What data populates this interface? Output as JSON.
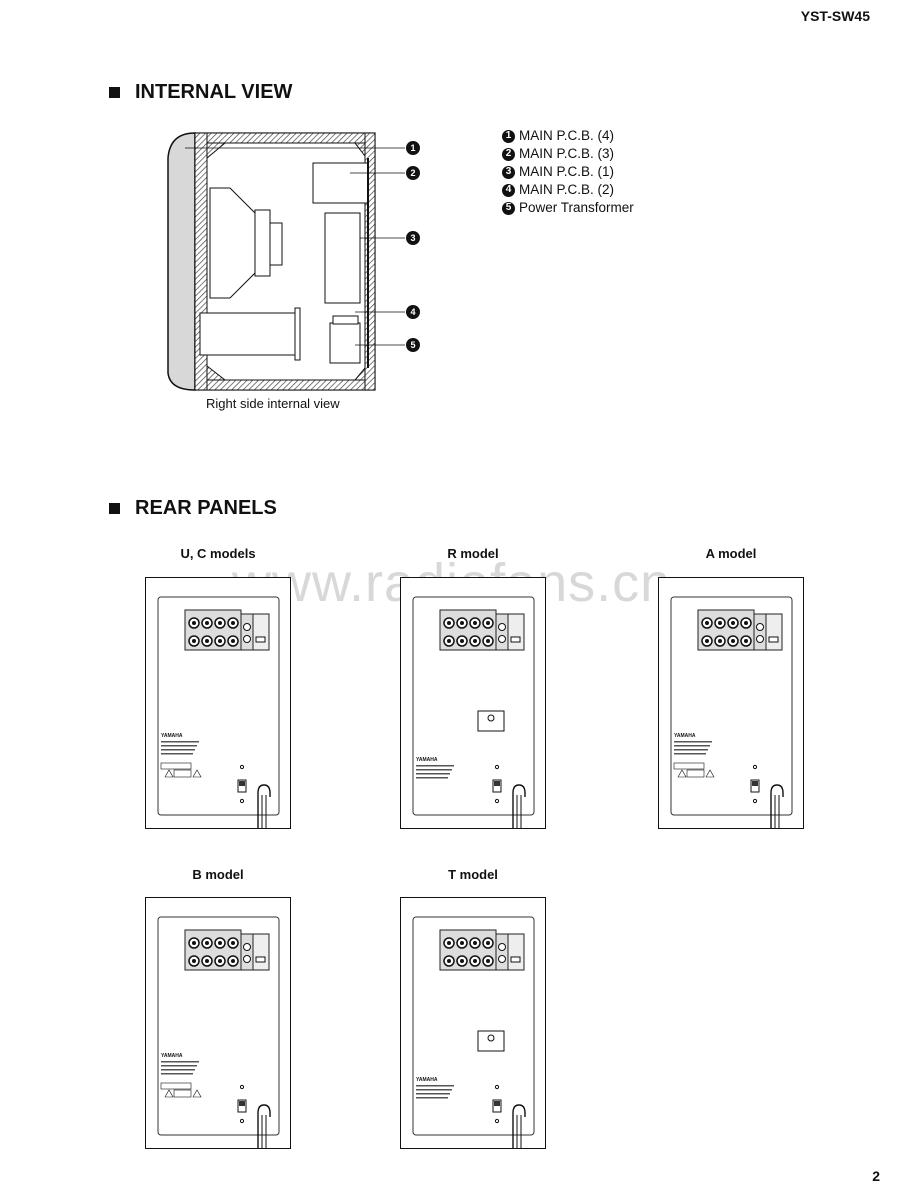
{
  "header": {
    "model": "YST-SW45"
  },
  "internal_view": {
    "title": "INTERNAL VIEW",
    "caption": "Right side internal view",
    "legend": [
      {
        "num": "1",
        "label": "MAIN P.C.B. (4)"
      },
      {
        "num": "2",
        "label": "MAIN P.C.B. (3)"
      },
      {
        "num": "3",
        "label": "MAIN P.C.B. (1)"
      },
      {
        "num": "4",
        "label": "MAIN P.C.B. (2)"
      },
      {
        "num": "5",
        "label": "Power Transformer"
      }
    ]
  },
  "rear_panels": {
    "title": "REAR PANELS",
    "models": [
      {
        "label": "U, C models",
        "variant": "uc"
      },
      {
        "label": "R model",
        "variant": "r"
      },
      {
        "label": "A model",
        "variant": "a"
      },
      {
        "label": "B model",
        "variant": "b"
      },
      {
        "label": "T model",
        "variant": "t"
      }
    ],
    "nameplate_logo": "YAMAHA"
  },
  "watermark": "www.radiofans.cn",
  "footer": {
    "page_number": "2"
  }
}
